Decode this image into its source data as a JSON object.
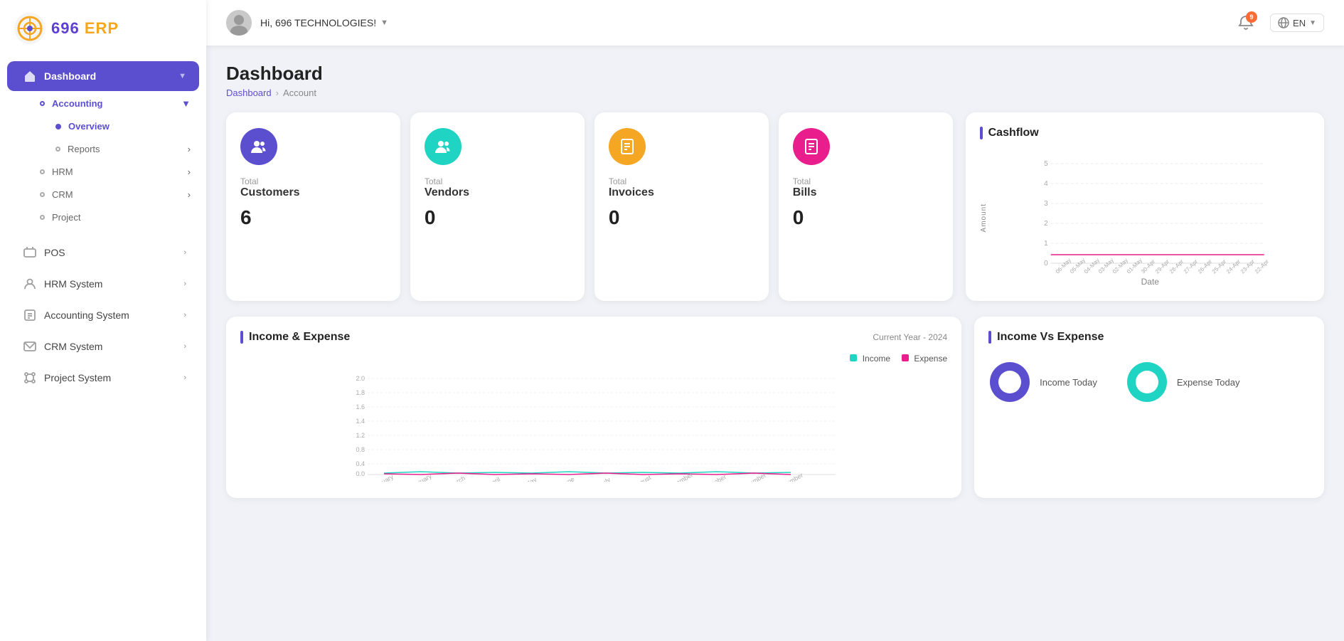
{
  "app": {
    "name": "696 ERP"
  },
  "topbar": {
    "greeting": "Hi, 696 TECHNOLOGIES!",
    "notification_count": "9",
    "language": "EN"
  },
  "breadcrumb": {
    "parent": "Dashboard",
    "current": "Account"
  },
  "page_title": "Dashboard",
  "sidebar": {
    "sections": [
      {
        "label": "Dashboard",
        "icon": "home",
        "active": true,
        "has_arrow": true,
        "sub_items": [
          {
            "label": "Accounting",
            "active": false,
            "has_arrow": true,
            "sub_items": [
              {
                "label": "Overview",
                "active": true
              },
              {
                "label": "Reports",
                "active": false,
                "has_arrow": true
              }
            ]
          },
          {
            "label": "HRM",
            "has_arrow": true
          },
          {
            "label": "CRM",
            "has_arrow": true
          },
          {
            "label": "Project",
            "has_arrow": false
          }
        ]
      }
    ],
    "system_items": [
      {
        "label": "POS",
        "has_arrow": true
      },
      {
        "label": "HRM System",
        "has_arrow": true
      },
      {
        "label": "Accounting System",
        "has_arrow": true
      },
      {
        "label": "CRM System",
        "has_arrow": true
      },
      {
        "label": "Project System",
        "has_arrow": true
      }
    ]
  },
  "stats": [
    {
      "label": "Total",
      "name": "Customers",
      "value": "6",
      "icon_color": "#5b4fcf",
      "icon": "customers"
    },
    {
      "label": "Total",
      "name": "Vendors",
      "value": "0",
      "icon_color": "#20d4c4",
      "icon": "vendors"
    },
    {
      "label": "Total",
      "name": "Invoices",
      "value": "0",
      "icon_color": "#f5a623",
      "icon": "invoices"
    },
    {
      "label": "Total",
      "name": "Bills",
      "value": "0",
      "icon_color": "#e91e8c",
      "icon": "bills"
    }
  ],
  "income_expense": {
    "title": "Income & Expense",
    "period": "Current Year - 2024",
    "legend": {
      "income_label": "Income",
      "income_color": "#20d4c4",
      "expense_label": "Expense",
      "expense_color": "#e91e8c"
    },
    "months": [
      "January",
      "February",
      "March",
      "April",
      "May",
      "June",
      "July",
      "August",
      "September",
      "October",
      "November",
      "December"
    ]
  },
  "cashflow": {
    "title": "Cashflow",
    "x_label": "Date",
    "y_label": "Amount",
    "y_values": [
      "5",
      "4",
      "3",
      "2",
      "1",
      "0"
    ],
    "dates": [
      "06-May",
      "05-May",
      "04-May",
      "03-May",
      "02-May",
      "01-May",
      "30-Apr",
      "29-Apr",
      "28-Apr",
      "27-Apr",
      "26-Apr",
      "25-Apr",
      "24-Apr",
      "23-Apr",
      "22-Apr"
    ]
  },
  "income_vs_expense": {
    "title": "Income Vs Expense",
    "income_label": "Income Today",
    "expense_label": "Expense Today"
  }
}
